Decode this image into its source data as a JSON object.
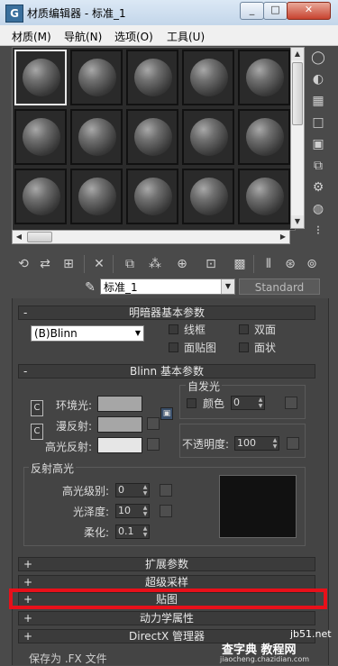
{
  "window": {
    "title": "材质编辑器 - 标准_1",
    "app_icon": "3ds-max-icon",
    "controls": {
      "minimize": "_",
      "maximize": "□",
      "close": "✕"
    }
  },
  "menubar": {
    "items": [
      "材质(M)",
      "导航(N)",
      "选项(O)",
      "工具(U)"
    ]
  },
  "sample_slots": {
    "rows": 3,
    "cols": 5,
    "selected_index": 0
  },
  "side_tools": [
    "sample-type-icon",
    "backlight-icon",
    "background-icon",
    "tiling-icon",
    "video-check-icon",
    "make-preview-icon",
    "options-icon",
    "select-by-material-icon",
    "map-navigator-icon"
  ],
  "toolbar": [
    "get-material-icon",
    "put-to-scene-icon",
    "assign-to-selection-icon",
    "reset-map-icon",
    "copy-material-icon",
    "make-unique-icon",
    "put-to-library-icon",
    "material-id-icon",
    "show-map-icon",
    "show-end-result-icon",
    "go-to-parent-icon",
    "go-forward-icon"
  ],
  "material": {
    "name": "标准_1",
    "type": "Standard"
  },
  "shader_basic": {
    "title": "明暗器基本参数",
    "shader": "(B)Blinn",
    "options": [
      "线框",
      "双面",
      "面贴图",
      "面状"
    ]
  },
  "blinn_basic": {
    "title": "Blinn 基本参数",
    "ambient": "环境光:",
    "diffuse": "漫反射:",
    "specular": "高光反射:",
    "self_illum_title": "自发光",
    "color_label": "颜色",
    "self_illum_value": "0",
    "opacity_label": "不透明度:",
    "opacity_value": "100",
    "spec_title": "反射高光",
    "spec_level_label": "高光级别:",
    "spec_level_value": "0",
    "gloss_label": "光泽度:",
    "gloss_value": "10",
    "soften_label": "柔化:",
    "soften_value": "0.1",
    "c_label": "C"
  },
  "rollouts": [
    {
      "sign": "+",
      "title": "扩展参数"
    },
    {
      "sign": "+",
      "title": "超级采样"
    },
    {
      "sign": "+",
      "title": "贴图"
    },
    {
      "sign": "+",
      "title": "动力学属性"
    },
    {
      "sign": "+",
      "title": "DirectX 管理器"
    }
  ],
  "rollout_minus": "-",
  "bottom_partial": "保存为 .FX 文件",
  "watermark": {
    "site": "jb51.net",
    "brand": "查字典 教程网",
    "url": "jiaocheng.chazidian.com"
  }
}
